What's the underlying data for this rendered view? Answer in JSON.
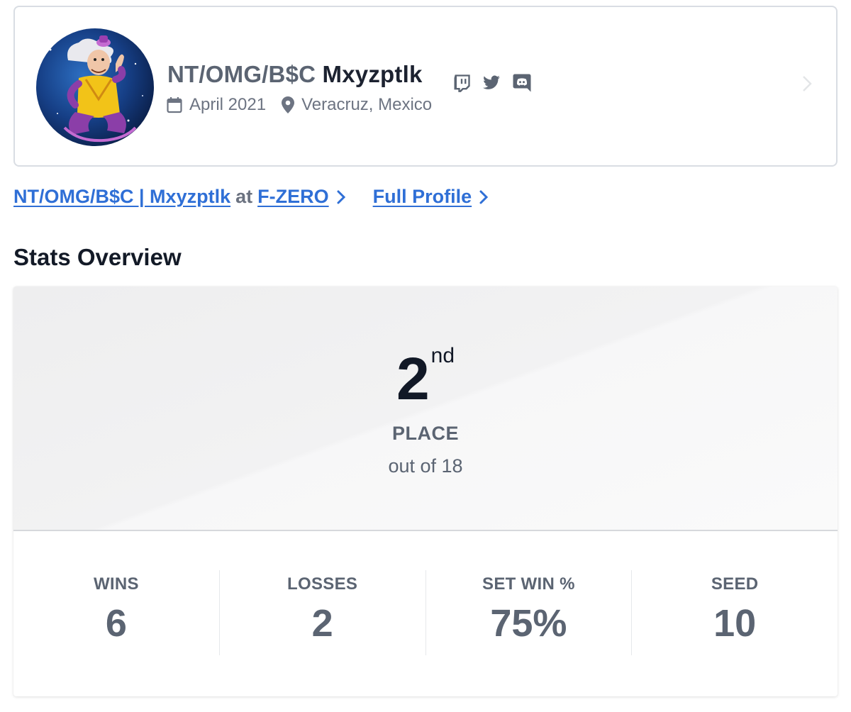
{
  "profile": {
    "prefix": "NT/OMG/B$C",
    "name": "Mxyzptlk",
    "joined": "April 2021",
    "location": "Veracruz, Mexico",
    "social_icons": [
      "twitch-icon",
      "twitter-icon",
      "discord-icon"
    ]
  },
  "links": {
    "player_link": "NT/OMG/B$C | Mxyzptlk",
    "at_text": "at",
    "game_link": "F-ZERO",
    "full_profile": "Full Profile"
  },
  "stats_title": "Stats Overview",
  "placement": {
    "place": "2",
    "suffix": "nd",
    "label": "PLACE",
    "out_of": "out of 18"
  },
  "stats": [
    {
      "label": "WINS",
      "value": "6"
    },
    {
      "label": "LOSSES",
      "value": "2"
    },
    {
      "label": "SET WIN %",
      "value": "75%"
    },
    {
      "label": "SEED",
      "value": "10"
    }
  ],
  "colors": {
    "link": "#2f6fd6",
    "text_dark": "#1c2230",
    "text_muted": "#5b6472"
  }
}
